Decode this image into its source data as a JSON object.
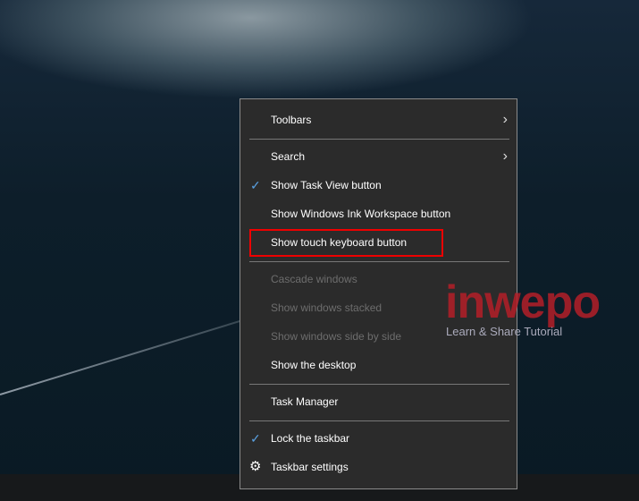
{
  "menu": {
    "toolbars": "Toolbars",
    "search": "Search",
    "task_view": "Show Task View button",
    "ink": "Show Windows Ink Workspace button",
    "touch_keyboard": "Show touch keyboard button",
    "cascade": "Cascade windows",
    "stacked": "Show windows stacked",
    "side_by_side": "Show windows side by side",
    "desktop": "Show the desktop",
    "task_manager": "Task Manager",
    "lock": "Lock the taskbar",
    "settings": "Taskbar settings"
  },
  "icons": {
    "check": "✓",
    "chevron": "›",
    "gear": "⚙"
  },
  "watermark": {
    "logo": "inwepo",
    "tagline": "Learn & Share Tutorial"
  },
  "colors": {
    "highlight": "#ee0000",
    "check": "#5aa0e0"
  }
}
